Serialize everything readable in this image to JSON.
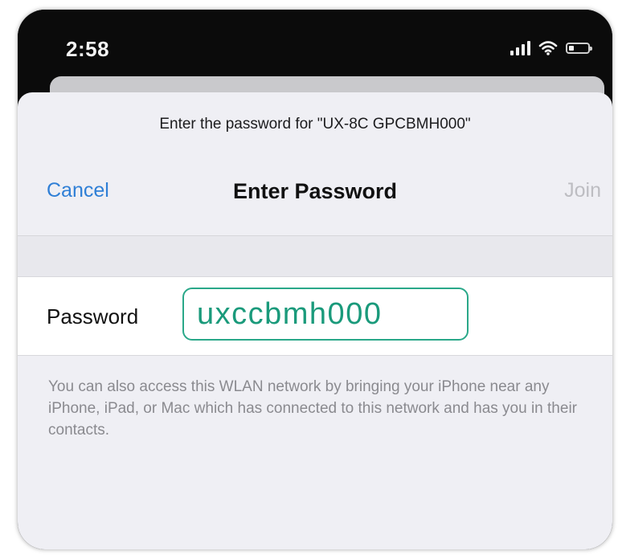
{
  "status_bar": {
    "time": "2:58",
    "battery_level": 0.25
  },
  "sheet": {
    "prompt": "Enter the password for \"UX-8C GPCBMH000\"",
    "nav": {
      "cancel_label": "Cancel",
      "title": "Enter Password",
      "join_label": "Join"
    },
    "password_field": {
      "label": "Password",
      "value": "uxccbmh000"
    },
    "helper_text": "You can also access this WLAN network by bringing your iPhone near any iPhone, iPad, or Mac which has connected to this network and has you in their contacts."
  },
  "colors": {
    "accent": "#2f7fd6",
    "field_highlight": "#2aa889",
    "disabled": "#bdbdc2"
  },
  "icons": [
    "cellular-signal-icon",
    "wifi-icon",
    "battery-icon"
  ]
}
